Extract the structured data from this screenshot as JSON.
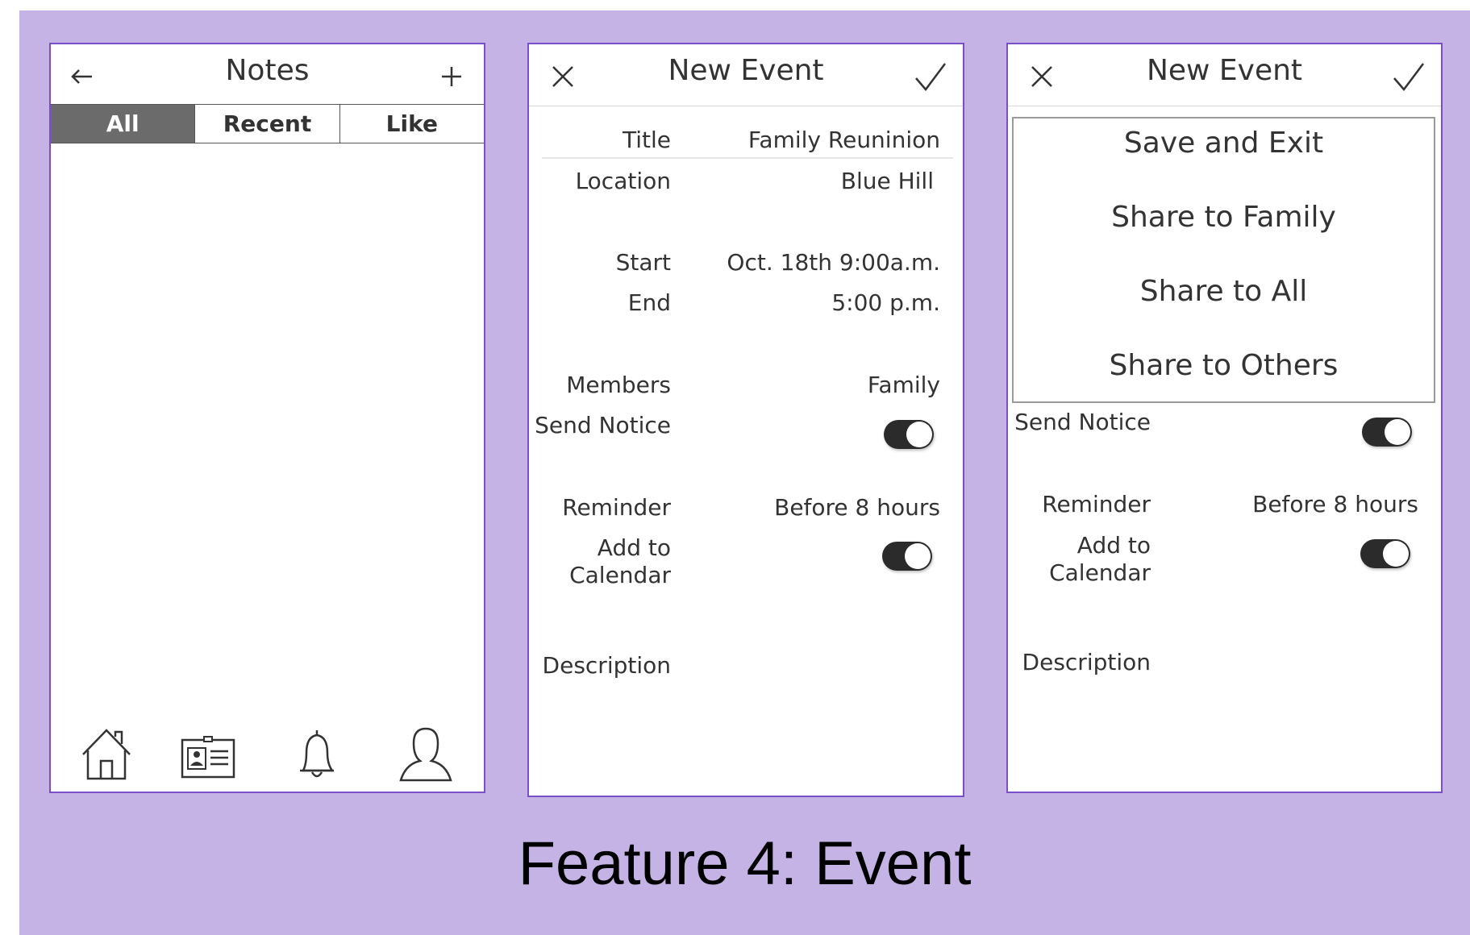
{
  "caption": "Feature 4: Event",
  "notes_screen": {
    "title": "Notes",
    "back_icon": "back-arrow-icon",
    "add_icon": "plus-icon",
    "tabs": [
      {
        "label": "All",
        "active": true
      },
      {
        "label": "Recent",
        "active": false
      },
      {
        "label": "Like",
        "active": false
      }
    ],
    "bottom_nav": [
      "home-icon",
      "contact-card-icon",
      "bell-icon",
      "profile-icon"
    ]
  },
  "event_screen": {
    "title": "New Event",
    "close_icon": "close-icon",
    "confirm_icon": "check-icon",
    "fields": {
      "title_label": "Title",
      "title_value": "Family Reuninion",
      "location_label": "Location",
      "location_value": "Blue Hill",
      "start_label": "Start",
      "start_value": "Oct. 18th  9:00a.m.",
      "end_label": "End",
      "end_value": "5:00 p.m.",
      "members_label": "Members",
      "members_value": "Family",
      "send_notice_label": "Send Notice",
      "send_notice_on": true,
      "reminder_label": "Reminder",
      "reminder_value": "Before 8 hours",
      "add_calendar_label_1": "Add to",
      "add_calendar_label_2": "Calendar",
      "add_calendar_on": true,
      "description_label": "Description"
    }
  },
  "event_menu_screen": {
    "title": "New Event",
    "close_icon": "close-icon",
    "confirm_icon": "check-icon",
    "menu": [
      "Save and Exit",
      "Share to Family",
      "Share to All",
      "Share to Others"
    ],
    "fields": {
      "send_notice_label": "Send Notice",
      "send_notice_on": true,
      "reminder_label": "Reminder",
      "reminder_value": "Before 8 hours",
      "add_calendar_label_1": "Add to",
      "add_calendar_label_2": "Calendar",
      "add_calendar_on": true,
      "description_label": "Description"
    }
  },
  "colors": {
    "background": "#c5b3e6",
    "frame_border": "#7b4fc9",
    "active_tab": "#6b6b6b",
    "toggle_on": "#2b2b2b"
  }
}
